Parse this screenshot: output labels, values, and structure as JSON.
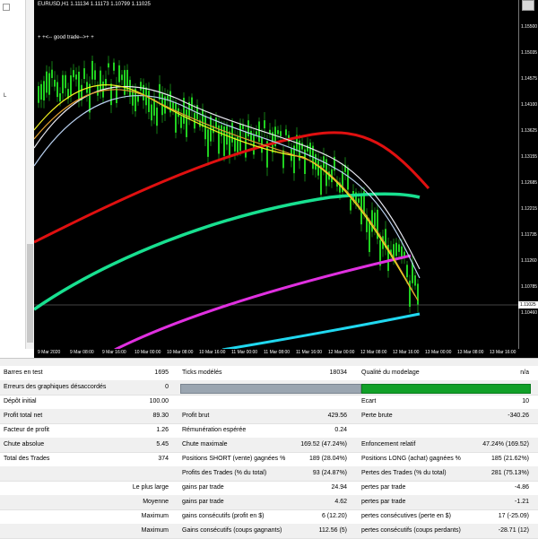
{
  "chart": {
    "title": "EURUSD,H1  1.11134 1.11173 1.10799 1.11025",
    "annotation": "+ +<-- good trade-->+ +",
    "y_ticks": [
      "1.15500",
      "1.15035",
      "1.14575",
      "1.14100",
      "1.13625",
      "1.13155",
      "1.12685",
      "1.12215",
      "1.11735",
      "1.11260",
      "1.10785",
      "1.10460"
    ],
    "price_tag": "1.11025",
    "x_ticks": [
      "9 Mar 2020",
      "9 Mar 08:00",
      "9 Mar 16:00",
      "10 Mar 00:00",
      "10 Mar 08:00",
      "10 Mar 16:00",
      "11 Mar 00:00",
      "11 Mar 08:00",
      "11 Mar 16:00",
      "12 Mar 00:00",
      "12 Mar 08:00",
      "12 Mar 16:00",
      "13 Mar 00:00",
      "13 Mar 08:00",
      "13 Mar 16:00"
    ],
    "left_label": "L",
    "colors": {
      "background": "#000000",
      "candles": "#20d020",
      "ma_red": "#e01010",
      "ma_green": "#18e090",
      "ma_magenta": "#e030e0",
      "ma_cyan": "#20d8f0",
      "ma_yellow": "#f0f020",
      "ma_orange": "#e0a030",
      "ma_white": "#e8e8f0",
      "ma_lightblue": "#b8d0f0"
    }
  },
  "report": {
    "rows": [
      {
        "c1": "Barres en test",
        "c2": "1695",
        "c3": "Ticks modélés",
        "c4": "18034",
        "c5": "Qualité du modelage",
        "c6": "n/a"
      },
      {
        "c1": "Erreurs des graphiques désaccordés",
        "c2": "0",
        "c3": "",
        "c4": "",
        "c5": "",
        "c6": ""
      },
      {
        "c1": "Dépôt initial",
        "c2": "100.00",
        "c3": "",
        "c4": "",
        "c5": "Ecart",
        "c6": "10"
      },
      {
        "c1": "Profit total net",
        "c2": "89.30",
        "c3": "Profit brut",
        "c4": "429.56",
        "c5": "Perte brute",
        "c6": "-340.26"
      },
      {
        "c1": "Facteur de profit",
        "c2": "1.26",
        "c3": "Rémunération espérée",
        "c4": "0.24",
        "c5": "",
        "c6": ""
      },
      {
        "c1": "Chute absolue",
        "c2": "5.45",
        "c3": "Chute maximale",
        "c4": "169.52 (47.24%)",
        "c5": "Enfoncement relatif",
        "c6": "47.24% (169.52)"
      },
      {
        "c1": "Total des Trades",
        "c2": "374",
        "c3": "Positions SHORT (vente) gagnées %",
        "c4": "189 (28.04%)",
        "c5": "Positions LONG (achat) gagnées %",
        "c6": "185 (21.62%)"
      },
      {
        "c1": "",
        "c2": "",
        "c3": "Profits des Trades (% du total)",
        "c4": "93 (24.87%)",
        "c5": "Pertes des Trades (% du total)",
        "c6": "281 (75.13%)"
      },
      {
        "c1": "",
        "c2": "Le plus large",
        "c3": "gains par trade",
        "c4": "24.94",
        "c5": "pertes par trade",
        "c6": "-4.86"
      },
      {
        "c1": "",
        "c2": "Moyenne",
        "c3": "gains par trade",
        "c4": "4.62",
        "c5": "pertes par trade",
        "c6": "-1.21"
      },
      {
        "c1": "",
        "c2": "Maximum",
        "c3": "gains consécutifs (profit en $)",
        "c4": "6 (12.20)",
        "c5": "pertes consécutives (perte en $)",
        "c6": "17 (-25.09)"
      },
      {
        "c1": "",
        "c2": "Maximum",
        "c3": "Gains consécutifs (coups gagnants)",
        "c4": "112.56 (5)",
        "c5": "pertes consécutifs (coups perdants)",
        "c6": "-28.71 (12)"
      }
    ]
  }
}
